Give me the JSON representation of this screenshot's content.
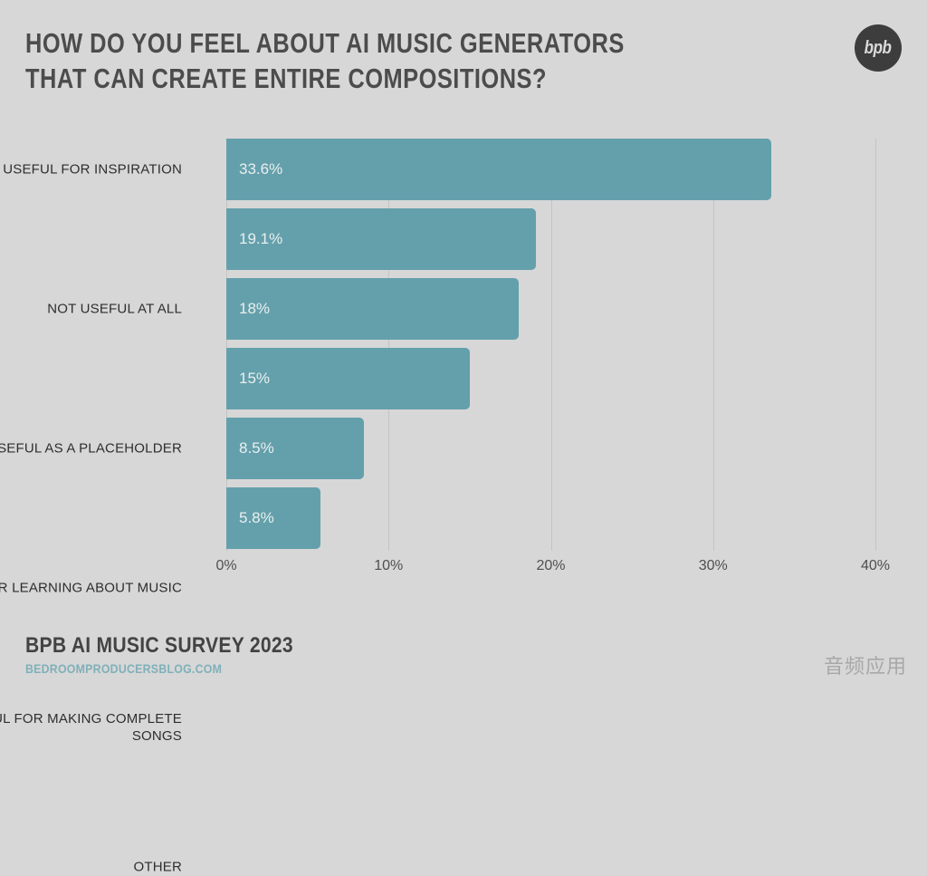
{
  "header": {
    "title": "HOW DO YOU FEEL ABOUT AI MUSIC GENERATORS THAT CAN CREATE ENTIRE COMPOSITIONS?",
    "logo_text": "bpb"
  },
  "footer": {
    "survey_name": "BPB AI MUSIC SURVEY 2023",
    "url": "BEDROOMPRODUCERSBLOG.COM",
    "watermark": "音频应用"
  },
  "colors": {
    "background": "#d7d7d7",
    "bar": "#64a0ab",
    "title": "#4c4c4c",
    "gridline": "#c4c4c4",
    "bar_label": "#e9eff0",
    "url": "#7fb0b9"
  },
  "chart_data": {
    "type": "bar",
    "orientation": "horizontal",
    "title": "HOW DO YOU FEEL ABOUT AI MUSIC GENERATORS THAT CAN CREATE ENTIRE COMPOSITIONS?",
    "xlabel": "",
    "ylabel": "",
    "categories": [
      "ONLY USEFUL FOR INSPIRATION",
      "NOT USEFUL AT ALL",
      "USEFUL AS A PLACEHOLDER",
      "USEFUL FOR LEARNING ABOUT MUSIC",
      "USEFUL FOR MAKING COMPLETE SONGS",
      "OTHER"
    ],
    "values": [
      33.6,
      19.1,
      18,
      15,
      8.5,
      5.8
    ],
    "data_labels": [
      "33.6%",
      "19.1%",
      "18%",
      "15%",
      "8.5%",
      "5.8%"
    ],
    "xlim": [
      0,
      40
    ],
    "xticks": [
      0,
      10,
      20,
      30,
      40
    ],
    "xtick_labels": [
      "0%",
      "10%",
      "20%",
      "30%",
      "40%"
    ],
    "grid": true,
    "legend": false
  }
}
